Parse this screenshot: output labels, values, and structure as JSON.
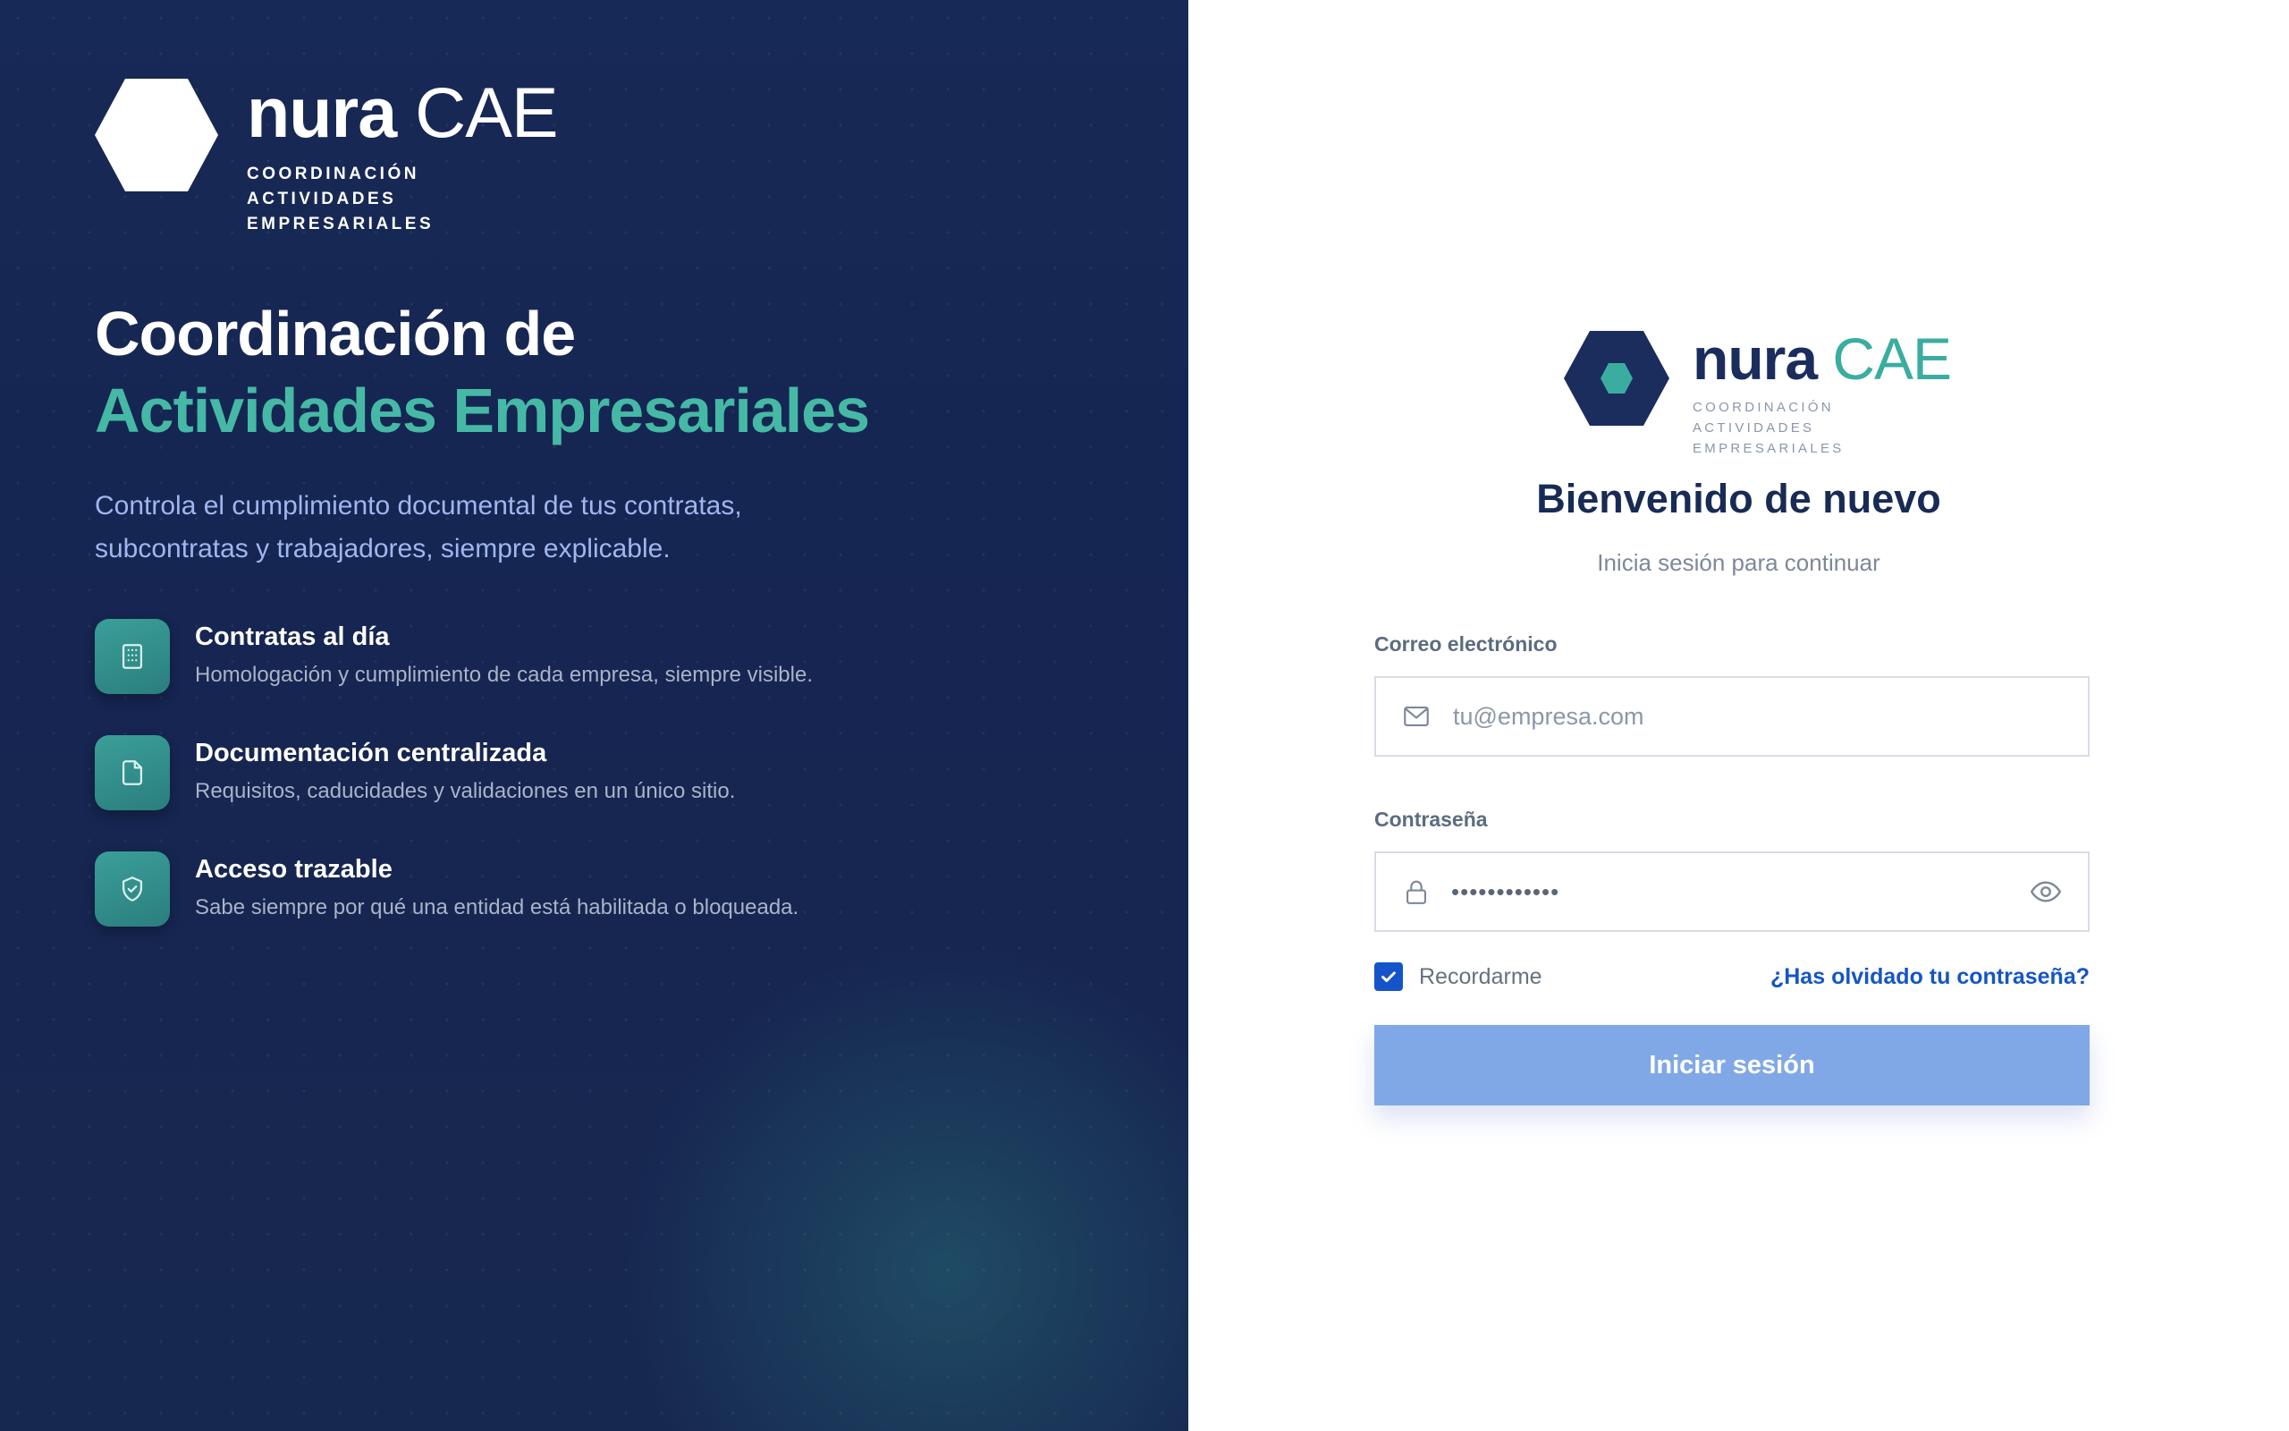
{
  "brand": {
    "name": "nura",
    "product": "CAE",
    "tagline": "COORDINACIÓN ACTIVIDADES EMPRESARIALES"
  },
  "hero": {
    "title_line1": "Coordinación de",
    "title_line2": "Actividades Empresariales",
    "description": "Controla el cumplimiento documental de tus contratas, subcontratas y trabajadores, siempre explicable."
  },
  "features": [
    {
      "icon": "building-icon",
      "title": "Contratas al día",
      "description": "Homologación y cumplimiento de cada empresa, siempre visible."
    },
    {
      "icon": "document-icon",
      "title": "Documentación centralizada",
      "description": "Requisitos, caducidades y validaciones en un único sitio."
    },
    {
      "icon": "shield-check-icon",
      "title": "Acceso trazable",
      "description": "Sabe siempre por qué una entidad está habilitada o bloqueada."
    }
  ],
  "login": {
    "title": "Bienvenido de nuevo",
    "subtitle": "Inicia sesión para continuar",
    "email_label": "Correo electrónico",
    "email_placeholder": "tu@empresa.com",
    "email_icon": "mail-icon",
    "password_label": "Contraseña",
    "password_value": "••••••••••••",
    "password_icon": "lock-icon",
    "show_password_icon": "eye-icon",
    "remember_label": "Recordarme",
    "remember_checked": true,
    "forgot_link": "¿Has olvidado tu contraseña?",
    "submit_label": "Iniciar sesión"
  },
  "colors": {
    "navy": "#172956",
    "teal": "#45b9a5",
    "primary_blue": "#1554c8",
    "button_disabled": "#80a8e6"
  }
}
